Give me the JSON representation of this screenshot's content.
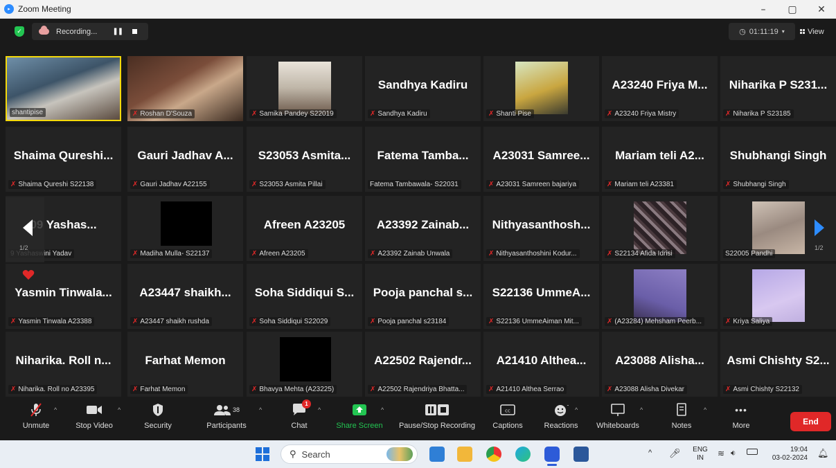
{
  "window": {
    "title": "Zoom Meeting",
    "minimize": "–",
    "restore": "▢",
    "close": "✕"
  },
  "topbar": {
    "recording_label": "Recording...",
    "timer": "01:11:19",
    "view_label": "View"
  },
  "gallery": {
    "page_indicator_left": "1/2",
    "page_indicator_right": "1/2",
    "tiles": [
      {
        "big": "",
        "label": "shantipise",
        "video": true,
        "muted": false
      },
      {
        "big": "",
        "label": "Roshan D'Souza",
        "video": true,
        "muted": true
      },
      {
        "big": "",
        "label": "Samika Pandey S22019",
        "video": true,
        "muted": true
      },
      {
        "big": "Sandhya Kadiru",
        "label": "Sandhya Kadiru",
        "video": false,
        "muted": true
      },
      {
        "big": "",
        "label": "Shanti Pise",
        "video": true,
        "muted": true
      },
      {
        "big": "A23240 Friya M...",
        "label": "A23240 Friya Mistry",
        "video": false,
        "muted": true
      },
      {
        "big": "Niharika P S231...",
        "label": "Niharika P S23185",
        "video": false,
        "muted": true
      },
      {
        "big": "Shaima Qureshi...",
        "label": "Shaima Qureshi S22138",
        "video": false,
        "muted": true
      },
      {
        "big": "Gauri Jadhav A...",
        "label": "Gauri Jadhav A22155",
        "video": false,
        "muted": true
      },
      {
        "big": "S23053 Asmita...",
        "label": "S23053 Asmita Pillai",
        "video": false,
        "muted": true
      },
      {
        "big": "Fatema Tamba...",
        "label": "Fatema Tambawala- S22031",
        "video": false,
        "muted": false
      },
      {
        "big": "A23031 Samree...",
        "label": "A23031 Samreen bajariya",
        "video": false,
        "muted": true
      },
      {
        "big": "Mariam teli A2...",
        "label": "Mariam teli A23381",
        "video": false,
        "muted": true
      },
      {
        "big": "Shubhangi Singh",
        "label": "Shubhangi Singh",
        "video": false,
        "muted": true
      },
      {
        "big": "09 Yashas...",
        "label": "9 Yashaswini Yadav",
        "video": false,
        "muted": false
      },
      {
        "big": "",
        "label": "Madiha Mulla- S22137",
        "video": "black",
        "muted": true
      },
      {
        "big": "Afreen A23205",
        "label": "Afreen A23205",
        "video": false,
        "muted": true
      },
      {
        "big": "A23392 Zainab...",
        "label": "A23392 Zainab Unwala",
        "video": false,
        "muted": true
      },
      {
        "big": "Nithyasanthosh...",
        "label": "Nithyasanthoshini Kodur...",
        "video": false,
        "muted": true
      },
      {
        "big": "",
        "label": "S22134 Afida Idrisi",
        "video": true,
        "muted": true
      },
      {
        "big": "",
        "label": "S22005 Pandhi",
        "video": true,
        "muted": false
      },
      {
        "big": "Yasmin Tinwala...",
        "label": "Yasmin Tinwala A23388",
        "video": false,
        "muted": true
      },
      {
        "big": "A23447 shaikh...",
        "label": "A23447 shaikh rushda",
        "video": false,
        "muted": true
      },
      {
        "big": "Soha Siddiqui S...",
        "label": "Soha Siddiqui S22029",
        "video": false,
        "muted": true
      },
      {
        "big": "Pooja panchal s...",
        "label": "Pooja panchal s23184",
        "video": false,
        "muted": true
      },
      {
        "big": "S22136 UmmeA...",
        "label": "S22136 UmmeAiman Mit...",
        "video": false,
        "muted": true
      },
      {
        "big": "",
        "label": "(A23284) Mehsham Peerb...",
        "video": true,
        "muted": true
      },
      {
        "big": "",
        "label": "Kriya Saliya",
        "video": true,
        "muted": true
      },
      {
        "big": "Niharika. Roll n...",
        "label": "Niharika. Roll no A23395",
        "video": false,
        "muted": true
      },
      {
        "big": "Farhat Memon",
        "label": "Farhat Memon",
        "video": false,
        "muted": true
      },
      {
        "big": "",
        "label": "Bhavya Mehta (A23225)",
        "video": "black",
        "muted": true
      },
      {
        "big": "A22502 Rajendr...",
        "label": "A22502 Rajendriya Bhatta...",
        "video": false,
        "muted": true
      },
      {
        "big": "A21410 Althea...",
        "label": "A21410 Althea Serrao",
        "video": false,
        "muted": true
      },
      {
        "big": "A23088 Alisha...",
        "label": "A23088 Alisha Divekar",
        "video": false,
        "muted": true
      },
      {
        "big": "Asmi Chishty S2...",
        "label": "Asmi Chishty S22132",
        "video": false,
        "muted": true
      }
    ]
  },
  "toolbar": {
    "unmute": "Unmute",
    "stop_video": "Stop Video",
    "security": "Security",
    "participants": "Participants",
    "participants_count": "38",
    "chat": "Chat",
    "chat_badge": "1",
    "share_screen": "Share Screen",
    "pause_stop_recording": "Pause/Stop Recording",
    "captions": "Captions",
    "reactions": "Reactions",
    "whiteboards": "Whiteboards",
    "notes": "Notes",
    "more": "More",
    "end": "End"
  },
  "taskbar": {
    "search_placeholder": "Search",
    "lang_line1": "ENG",
    "lang_line2": "IN",
    "time": "19:04",
    "date": "03-02-2024"
  },
  "colors": {
    "accent": "#2d8cff",
    "end_red": "#e02828",
    "share_green": "#23c552",
    "active_speaker": "#f5d90a"
  }
}
